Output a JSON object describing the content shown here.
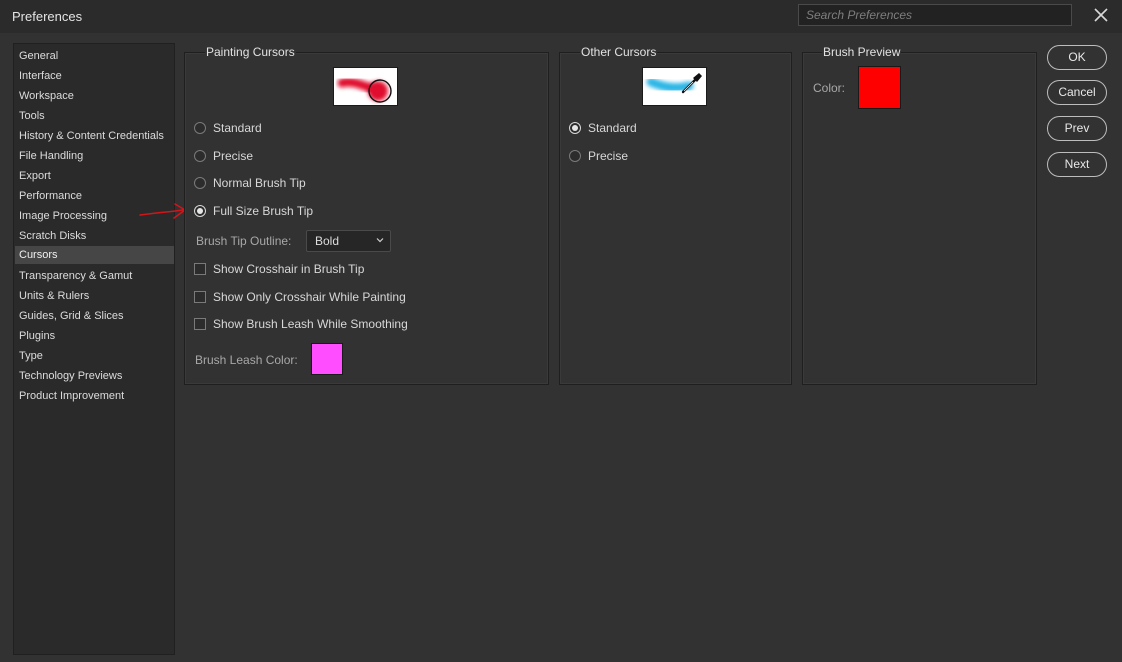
{
  "window": {
    "title": "Preferences"
  },
  "search": {
    "placeholder": "Search Preferences"
  },
  "sidebar": {
    "items": [
      {
        "label": "General"
      },
      {
        "label": "Interface"
      },
      {
        "label": "Workspace"
      },
      {
        "label": "Tools"
      },
      {
        "label": "History & Content Credentials"
      },
      {
        "label": "File Handling"
      },
      {
        "label": "Export"
      },
      {
        "label": "Performance"
      },
      {
        "label": "Image Processing"
      },
      {
        "label": "Scratch Disks"
      },
      {
        "label": "Cursors",
        "selected": true
      },
      {
        "label": "Transparency & Gamut"
      },
      {
        "label": "Units & Rulers"
      },
      {
        "label": "Guides, Grid & Slices"
      },
      {
        "label": "Plugins"
      },
      {
        "label": "Type"
      },
      {
        "label": "Technology Previews"
      },
      {
        "label": "Product Improvement"
      }
    ]
  },
  "painting_cursors": {
    "title": "Painting Cursors",
    "options": [
      {
        "label": "Standard",
        "checked": false
      },
      {
        "label": "Precise",
        "checked": false
      },
      {
        "label": "Normal Brush Tip",
        "checked": false
      },
      {
        "label": "Full Size Brush Tip",
        "checked": true
      }
    ],
    "brush_tip_outline": {
      "label": "Brush Tip Outline:",
      "value": "Bold"
    },
    "checkboxes": [
      {
        "label": "Show Crosshair in Brush Tip",
        "checked": false
      },
      {
        "label": "Show Only Crosshair While Painting",
        "checked": false
      },
      {
        "label": "Show Brush Leash While Smoothing",
        "checked": false
      }
    ],
    "brush_leash_color": {
      "label": "Brush Leash Color:",
      "color": "#ff4dff"
    }
  },
  "other_cursors": {
    "title": "Other Cursors",
    "options": [
      {
        "label": "Standard",
        "checked": true
      },
      {
        "label": "Precise",
        "checked": false
      }
    ]
  },
  "brush_preview": {
    "title": "Brush Preview",
    "color_label": "Color:",
    "color": "#ff0000"
  },
  "buttons": {
    "ok": "OK",
    "cancel": "Cancel",
    "prev": "Prev",
    "next": "Next"
  },
  "annotation": {
    "arrow_color": "#d0161b"
  }
}
